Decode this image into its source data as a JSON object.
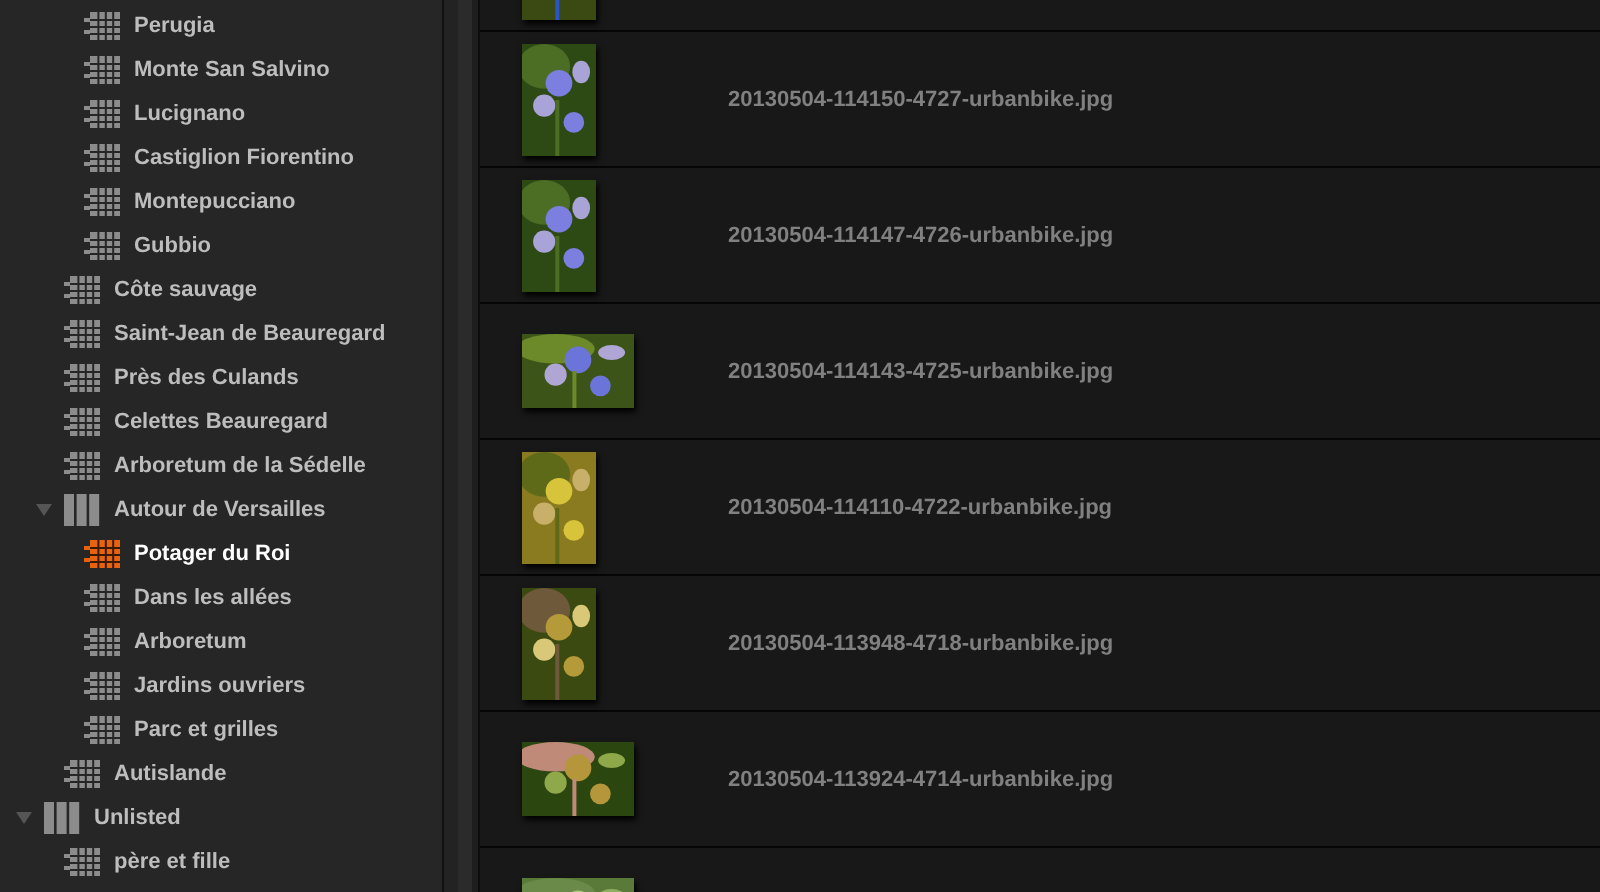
{
  "sidebar": {
    "items": [
      {
        "children": [
          {
            "children": [
              {
                "label": "Perugia",
                "kind": "album",
                "selected": false
              },
              {
                "label": "Monte San Salvino",
                "kind": "album",
                "selected": false
              },
              {
                "label": "Lucignano",
                "kind": "album",
                "selected": false
              },
              {
                "label": "Castiglion Fiorentino",
                "kind": "album",
                "selected": false
              },
              {
                "label": "Montepucciano",
                "kind": "album",
                "selected": false
              },
              {
                "label": "Gubbio",
                "kind": "album",
                "selected": false
              }
            ]
          },
          {
            "label": "Côte sauvage",
            "kind": "album",
            "selected": false
          },
          {
            "label": "Saint-Jean de Beauregard",
            "kind": "album",
            "selected": false
          },
          {
            "label": "Près des Culands",
            "kind": "album",
            "selected": false
          },
          {
            "label": "Celettes Beauregard",
            "kind": "album",
            "selected": false
          },
          {
            "label": "Arboretum de la Sédelle",
            "kind": "album",
            "selected": false
          },
          {
            "label": "Autour de Versailles",
            "kind": "folder",
            "selected": false,
            "expanded": true,
            "children": [
              {
                "label": "Potager du Roi",
                "kind": "album",
                "selected": true
              },
              {
                "label": "Dans les allées",
                "kind": "album",
                "selected": false
              },
              {
                "label": "Arboretum",
                "kind": "album",
                "selected": false
              },
              {
                "label": "Jardins ouvriers",
                "kind": "album",
                "selected": false
              },
              {
                "label": "Parc et grilles",
                "kind": "album",
                "selected": false
              }
            ]
          },
          {
            "label": "Autislande",
            "kind": "album",
            "selected": false
          }
        ]
      },
      {
        "label": "Unlisted",
        "kind": "folder",
        "selected": false,
        "expanded": true,
        "children": [
          {
            "label": "père et fille",
            "kind": "album",
            "selected": false
          }
        ]
      }
    ]
  },
  "photos": [
    {
      "landscape": false
    },
    {
      "landscape": false,
      "filename": "20130504-114150-4727-urbanbike.jpg"
    },
    {
      "landscape": false,
      "filename": "20130504-114147-4726-urbanbike.jpg"
    },
    {
      "landscape": true,
      "filename": "20130504-114143-4725-urbanbike.jpg"
    },
    {
      "landscape": false,
      "filename": "20130504-114110-4722-urbanbike.jpg"
    },
    {
      "landscape": false,
      "filename": "20130504-113948-4718-urbanbike.jpg"
    },
    {
      "landscape": true,
      "filename": "20130504-113924-4714-urbanbike.jpg"
    },
    {
      "landscape": true
    }
  ]
}
